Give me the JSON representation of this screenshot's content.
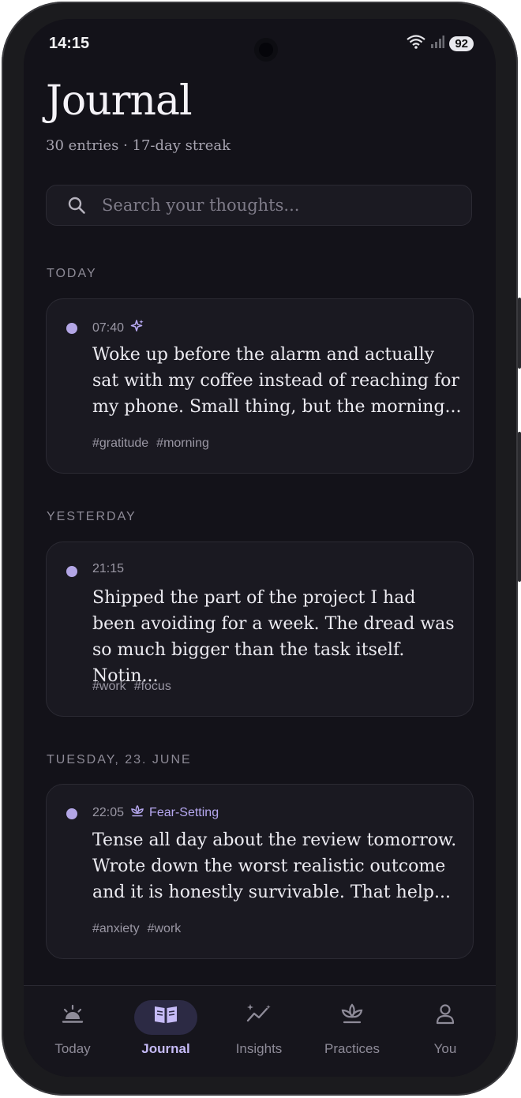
{
  "status": {
    "time": "14:15",
    "battery": "92",
    "wifi_badge": "5"
  },
  "header": {
    "title": "Journal",
    "subtitle": "30 entries · 17-day streak"
  },
  "search": {
    "placeholder": "Search your thoughts..."
  },
  "sections": [
    {
      "label": "TODAY",
      "entry": {
        "time": "07:40",
        "icon": "sparkles-icon",
        "practice": "",
        "text": "Woke up before the alarm and actually sat with my coffee instead of reaching for my phone. Small thing, but the morning...",
        "tags": [
          "#gratitude",
          "#morning"
        ]
      }
    },
    {
      "label": "YESTERDAY",
      "entry": {
        "time": "21:15",
        "practice": "",
        "text": "Shipped the part of the project I had been avoiding for a week. The dread was so much bigger than the task itself. Notin...",
        "tags": [
          "#work",
          "#focus"
        ]
      }
    },
    {
      "label": "TUESDAY, 23. JUNE",
      "entry": {
        "time": "22:05",
        "icon": "lotus-icon",
        "practice": "Fear-Setting",
        "text": "Tense all day about the review tomorrow. Wrote down the worst realistic outcome and it is honestly survivable. That help...",
        "tags": [
          "#anxiety",
          "#work"
        ]
      }
    }
  ],
  "nav": {
    "items": [
      {
        "label": "Today",
        "icon": "sunrise-icon"
      },
      {
        "label": "Journal",
        "icon": "book-icon",
        "active": true
      },
      {
        "label": "Insights",
        "icon": "trend-sparkle-icon"
      },
      {
        "label": "Practices",
        "icon": "lotus-icon"
      },
      {
        "label": "You",
        "icon": "person-icon"
      }
    ]
  },
  "colors": {
    "background": "#131219",
    "card": "#1a1921",
    "accent": "#b6a8f0",
    "dot": "#b3a6e6"
  }
}
